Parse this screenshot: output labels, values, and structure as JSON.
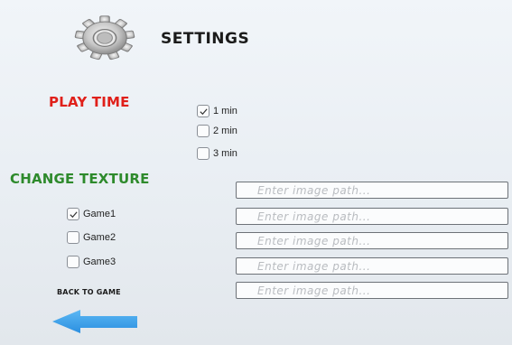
{
  "header": {
    "title": "SETTINGS",
    "icon": "gear-icon"
  },
  "play_time": {
    "title": "PLAY TIME",
    "title_color": "#e0201a",
    "options": [
      {
        "label": "1 min",
        "checked": true
      },
      {
        "label": "2 min",
        "checked": false
      },
      {
        "label": "3 min",
        "checked": false
      }
    ]
  },
  "change_texture": {
    "title": "CHANGE TEXTURE",
    "title_color": "#2e8a2c",
    "options": [
      {
        "label": "Game1",
        "checked": true
      },
      {
        "label": "Game2",
        "checked": false
      },
      {
        "label": "Game3",
        "checked": false
      }
    ],
    "path_placeholder": "Enter image path..."
  },
  "back": {
    "label": "BACK TO GAME",
    "icon": "left-arrow-icon",
    "arrow_color": "#3aa0ea"
  }
}
